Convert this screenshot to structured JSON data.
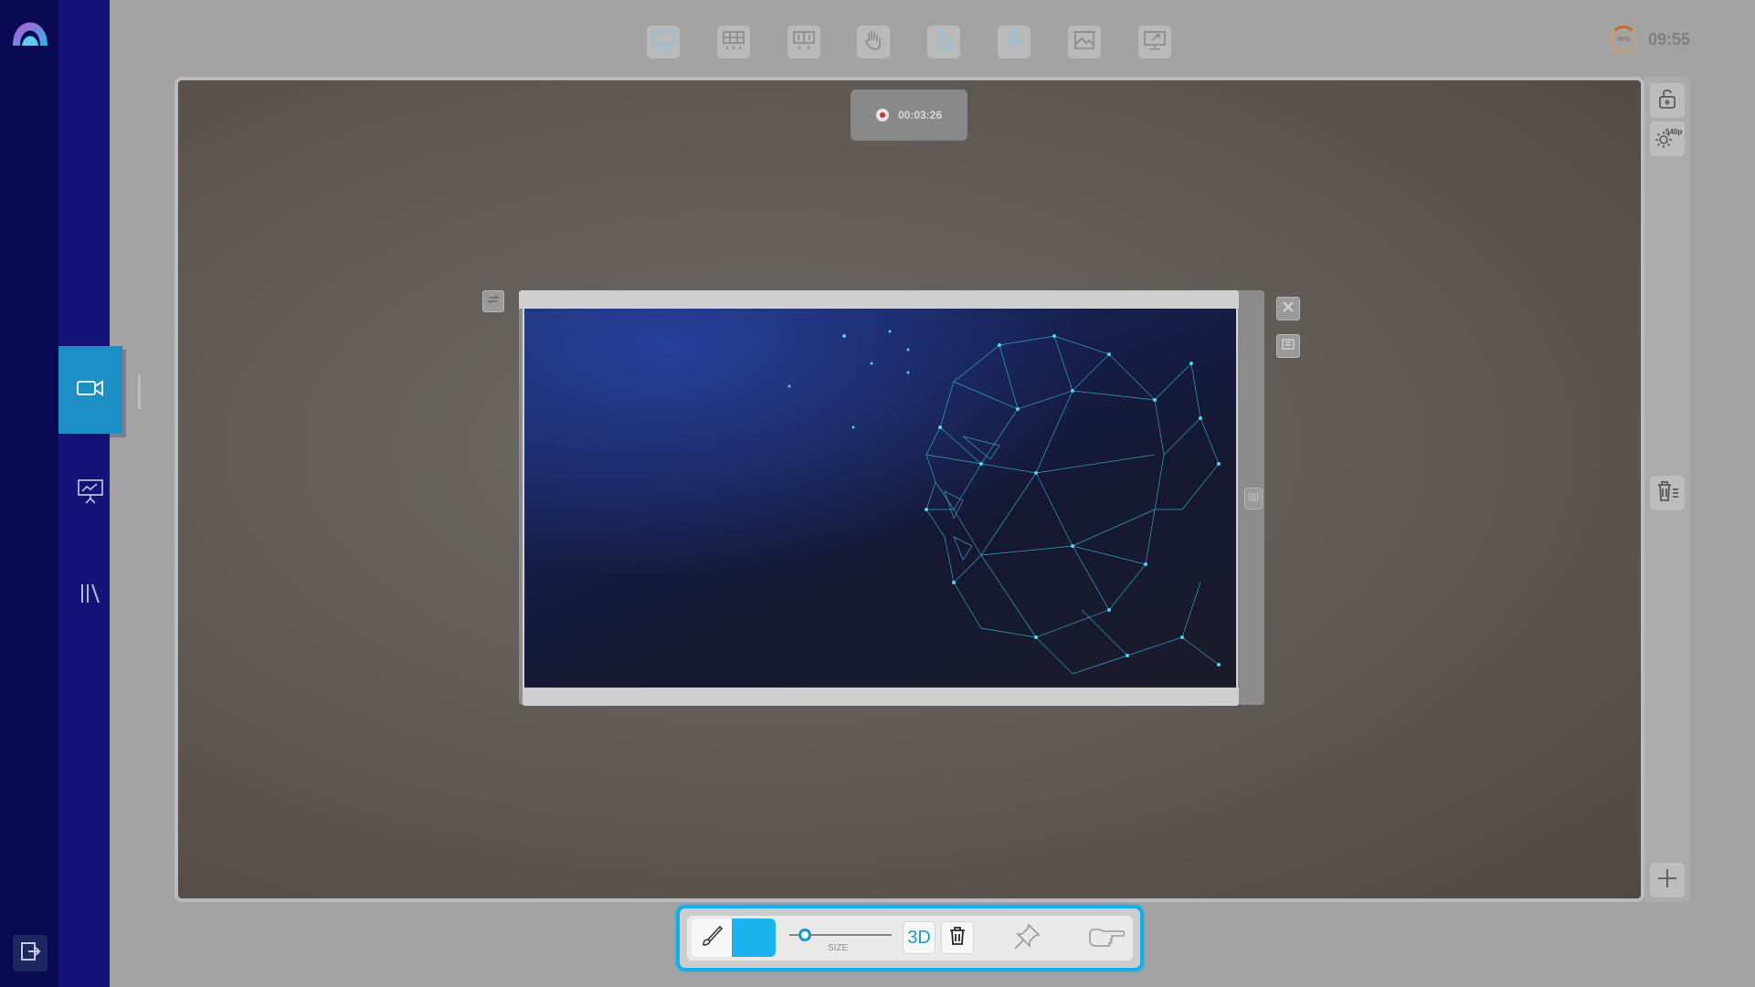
{
  "app": {
    "clock": "09:55",
    "battery_label": "35%"
  },
  "rail": {
    "items": [
      {
        "name": "video",
        "icon": "video-camera-icon",
        "active": true
      },
      {
        "name": "presentation",
        "icon": "presentation-board-icon",
        "active": false
      },
      {
        "name": "library",
        "icon": "library-icon",
        "active": false
      }
    ],
    "exit_icon": "exit-icon"
  },
  "top_toolbar": {
    "tools": [
      "monitor-icon",
      "screen-grid-icon",
      "screen-split-icon",
      "hand-gesture-icon",
      "touch-pointer-icon",
      "microphone-icon",
      "image-frame-icon",
      "screen-share-icon"
    ]
  },
  "stage": {
    "recording_time": "00:03:26"
  },
  "side_panel": {
    "quality_label": "540p",
    "tools": [
      "unlock-icon",
      "settings-quality-icon",
      "clear-all-icon",
      "add-crosshair-icon"
    ]
  },
  "window": {
    "image_description_icon": "ai-face-image",
    "buttons": [
      "close-icon",
      "expand-icon",
      "rotate-icon",
      "camera-icon"
    ]
  },
  "draw_bar": {
    "brush_color": "#1bb3ee",
    "size_label": "SIZE",
    "size_value": 0.1,
    "mode_3d_label": "3D"
  },
  "colors": {
    "accent": "#12b0ea",
    "rail_dark": "#0a0a52",
    "rail": "#141478",
    "active_tab": "#1e8fc4"
  }
}
